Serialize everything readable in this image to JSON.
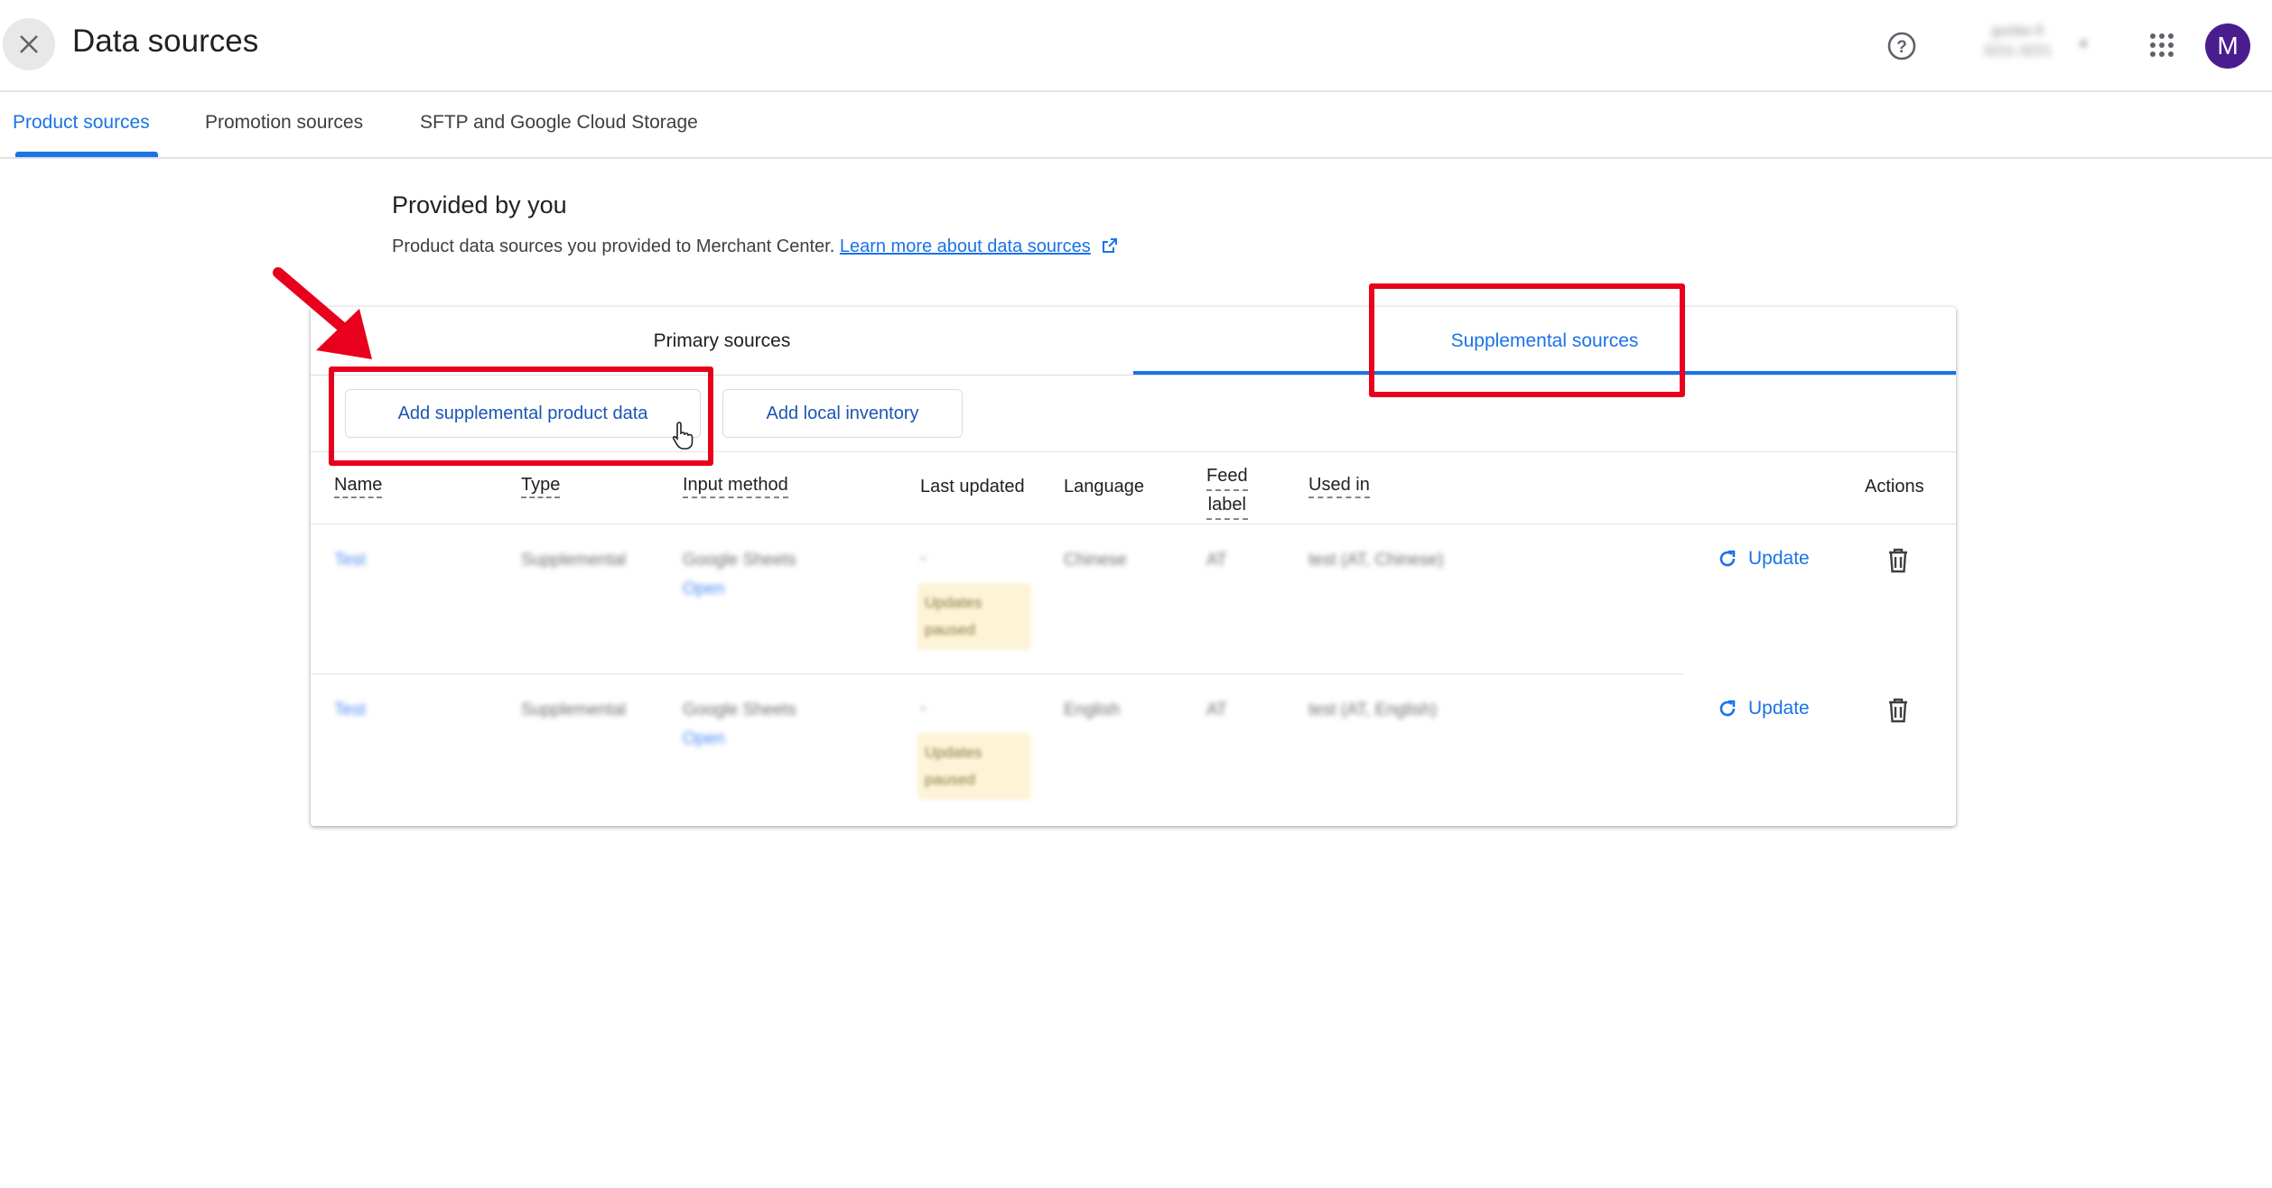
{
  "header": {
    "title": "Data sources",
    "close_icon": "close-icon",
    "help_icon": "help-icon",
    "account_label_line1": "goobe-fi",
    "account_label_line2": "3211-3221",
    "apps_icon": "apps-grid-icon",
    "avatar_letter": "M",
    "avatar_color": "#4a1d8f"
  },
  "tabs": [
    {
      "label": "Product sources",
      "active": true
    },
    {
      "label": "Promotion sources",
      "active": false
    },
    {
      "label": "SFTP and Google Cloud Storage",
      "active": false
    }
  ],
  "section": {
    "title": "Provided by you",
    "description": "Product data sources you provided to Merchant Center.",
    "learn_more": "Learn more about data sources"
  },
  "subtabs": {
    "primary": "Primary sources",
    "supplemental": "Supplemental sources",
    "active": "supplemental"
  },
  "actions": {
    "add_supplemental": "Add supplemental product data",
    "add_local_inventory": "Add local inventory"
  },
  "table": {
    "columns": [
      "Name",
      "Type",
      "Input method",
      "Last updated",
      "Language",
      "Feed",
      "label",
      "Used in",
      "Actions"
    ],
    "rows": [
      {
        "name": "Test",
        "type": "Supplemental",
        "input": "Google Sheets",
        "input_link": "Open",
        "last_updated": "-",
        "status": "Updates paused",
        "language": "Chinese",
        "feed_label": "AT",
        "used_in": "test (AT, Chinese)",
        "update_label": "Update"
      },
      {
        "name": "Test",
        "type": "Supplemental",
        "input": "Google Sheets",
        "input_link": "Open",
        "last_updated": "-",
        "status": "Updates paused",
        "language": "English",
        "feed_label": "AT",
        "used_in": "test (AT, English)",
        "update_label": "Update"
      }
    ]
  },
  "colors": {
    "accent": "#1a73e8",
    "annotation": "#e8001c"
  }
}
